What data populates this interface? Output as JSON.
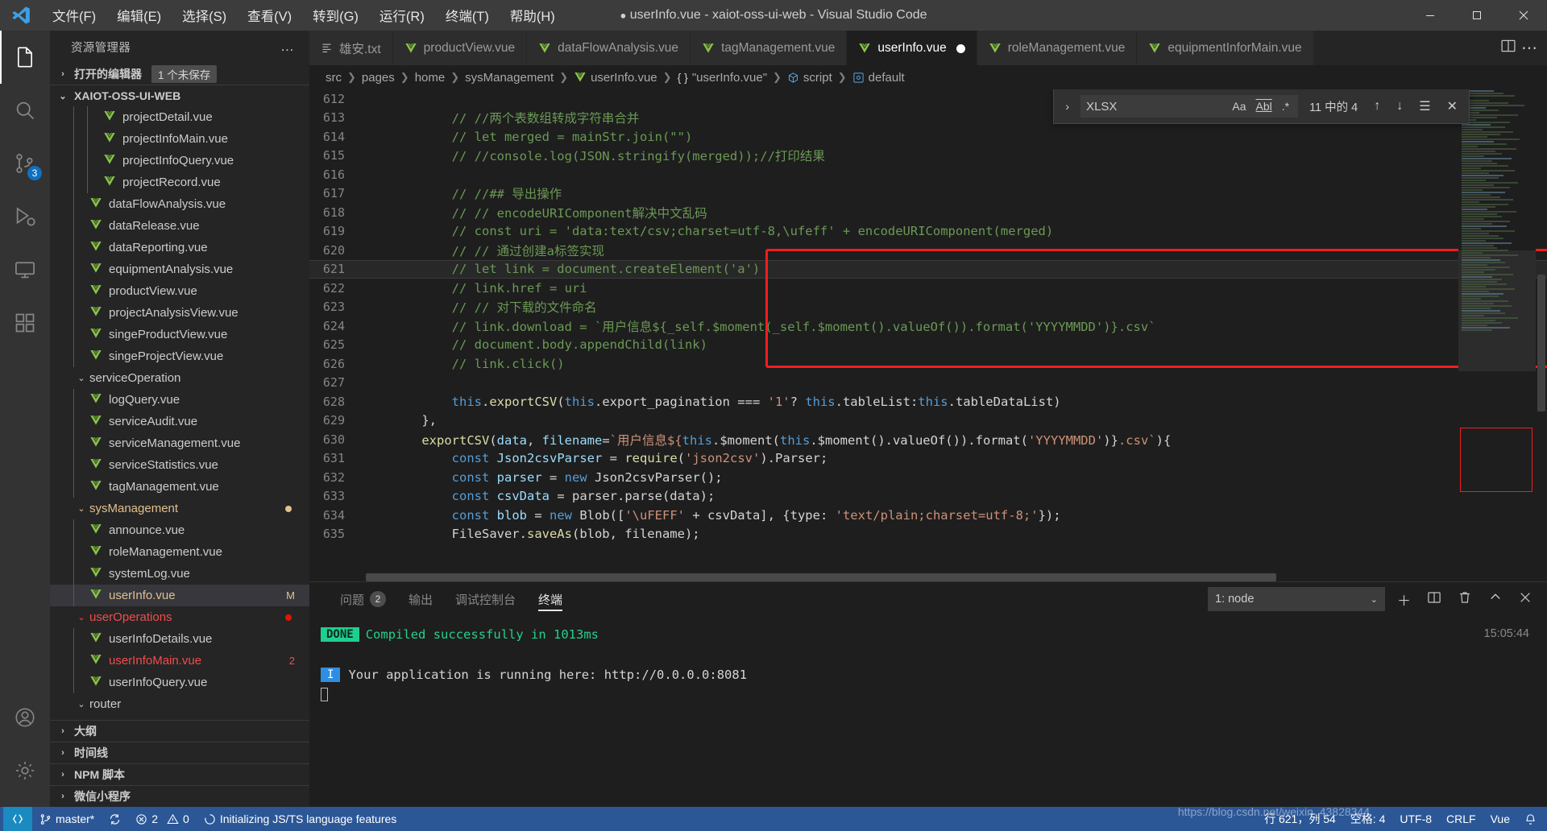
{
  "window": {
    "title_dirty_marker": "●",
    "title": "userInfo.vue - xaiot-oss-ui-web - Visual Studio Code",
    "menus": [
      "文件(F)",
      "编辑(E)",
      "选择(S)",
      "查看(V)",
      "转到(G)",
      "运行(R)",
      "终端(T)",
      "帮助(H)"
    ],
    "controls": {
      "minimize": "―",
      "maximize": "☐",
      "close": "✕"
    }
  },
  "activitybar": {
    "items": [
      {
        "name": "explorer",
        "icon": "files-icon",
        "badge": ""
      },
      {
        "name": "search",
        "icon": "search-icon",
        "badge": ""
      },
      {
        "name": "source-control",
        "icon": "source-control-icon",
        "badge": "3"
      },
      {
        "name": "run-debug",
        "icon": "run-debug-icon",
        "badge": ""
      },
      {
        "name": "remote-explorer",
        "icon": "remote-explorer-icon",
        "badge": ""
      },
      {
        "name": "extensions",
        "icon": "extensions-icon",
        "badge": ""
      }
    ],
    "bottom": [
      {
        "name": "accounts",
        "icon": "account-icon"
      },
      {
        "name": "settings",
        "icon": "gear-icon"
      }
    ]
  },
  "sidebar": {
    "header": "资源管理器",
    "more_actions": "…",
    "open_editors": {
      "label": "打开的编辑器",
      "badge": "1 个未保存",
      "chevron": "›"
    },
    "workspace": {
      "label": "XAIOT-OSS-UI-WEB",
      "chevron": "⌄"
    },
    "tree": [
      {
        "label": "projectDetail.vue",
        "depth": 3,
        "type": "vue",
        "state": "normal"
      },
      {
        "label": "projectInfoMain.vue",
        "depth": 3,
        "type": "vue",
        "state": "normal"
      },
      {
        "label": "projectInfoQuery.vue",
        "depth": 3,
        "type": "vue",
        "state": "normal"
      },
      {
        "label": "projectRecord.vue",
        "depth": 3,
        "type": "vue",
        "state": "normal"
      },
      {
        "label": "dataFlowAnalysis.vue",
        "depth": 2,
        "type": "vue",
        "state": "normal"
      },
      {
        "label": "dataRelease.vue",
        "depth": 2,
        "type": "vue",
        "state": "normal"
      },
      {
        "label": "dataReporting.vue",
        "depth": 2,
        "type": "vue",
        "state": "normal"
      },
      {
        "label": "equipmentAnalysis.vue",
        "depth": 2,
        "type": "vue",
        "state": "normal"
      },
      {
        "label": "productView.vue",
        "depth": 2,
        "type": "vue",
        "state": "normal"
      },
      {
        "label": "projectAnalysisView.vue",
        "depth": 2,
        "type": "vue",
        "state": "normal"
      },
      {
        "label": "singeProductView.vue",
        "depth": 2,
        "type": "vue",
        "state": "normal"
      },
      {
        "label": "singeProjectView.vue",
        "depth": 2,
        "type": "vue",
        "state": "normal"
      },
      {
        "label": "serviceOperation",
        "depth": 1,
        "type": "folder-open",
        "state": "normal"
      },
      {
        "label": "logQuery.vue",
        "depth": 2,
        "type": "vue",
        "state": "normal"
      },
      {
        "label": "serviceAudit.vue",
        "depth": 2,
        "type": "vue",
        "state": "normal"
      },
      {
        "label": "serviceManagement.vue",
        "depth": 2,
        "type": "vue",
        "state": "normal"
      },
      {
        "label": "serviceStatistics.vue",
        "depth": 2,
        "type": "vue",
        "state": "normal"
      },
      {
        "label": "tagManagement.vue",
        "depth": 2,
        "type": "vue",
        "state": "normal"
      },
      {
        "label": "sysManagement",
        "depth": 1,
        "type": "folder-open",
        "state": "modified-folder",
        "badge_dot": "#e2c08d"
      },
      {
        "label": "announce.vue",
        "depth": 2,
        "type": "vue",
        "state": "normal"
      },
      {
        "label": "roleManagement.vue",
        "depth": 2,
        "type": "vue",
        "state": "normal"
      },
      {
        "label": "systemLog.vue",
        "depth": 2,
        "type": "vue",
        "state": "normal"
      },
      {
        "label": "userInfo.vue",
        "depth": 2,
        "type": "vue",
        "state": "modified",
        "badge": "M",
        "selected": true
      },
      {
        "label": "userOperations",
        "depth": 1,
        "type": "folder-open",
        "state": "error-folder",
        "badge_dot": "#e51400"
      },
      {
        "label": "userInfoDetails.vue",
        "depth": 2,
        "type": "vue",
        "state": "normal"
      },
      {
        "label": "userInfoMain.vue",
        "depth": 2,
        "type": "vue",
        "state": "error",
        "badge": "2"
      },
      {
        "label": "userInfoQuery.vue",
        "depth": 2,
        "type": "vue",
        "state": "normal"
      },
      {
        "label": "router",
        "depth": 1,
        "type": "folder-open",
        "state": "normal"
      }
    ],
    "panels": [
      {
        "label": "大纲",
        "chevron": "›"
      },
      {
        "label": "时间线",
        "chevron": "›"
      },
      {
        "label": "NPM 脚本",
        "chevron": "›"
      },
      {
        "label": "微信小程序",
        "chevron": "›"
      }
    ]
  },
  "editor": {
    "tabs": [
      {
        "label": "雄安.txt",
        "icon": "txt-icon",
        "active": false,
        "dirty": false
      },
      {
        "label": "productView.vue",
        "icon": "vue-icon",
        "active": false,
        "dirty": false
      },
      {
        "label": "dataFlowAnalysis.vue",
        "icon": "vue-icon",
        "active": false,
        "dirty": false
      },
      {
        "label": "tagManagement.vue",
        "icon": "vue-icon",
        "active": false,
        "dirty": false
      },
      {
        "label": "userInfo.vue",
        "icon": "vue-icon",
        "active": true,
        "dirty": true
      },
      {
        "label": "roleManagement.vue",
        "icon": "vue-icon",
        "active": false,
        "dirty": false
      },
      {
        "label": "equipmentInforMain.vue",
        "icon": "vue-icon",
        "active": false,
        "dirty": false
      }
    ],
    "tab_actions": [
      {
        "name": "split-editor-icon",
        "glyph": "▤"
      },
      {
        "name": "more-actions-icon",
        "glyph": "⋯"
      }
    ],
    "breadcrumb": [
      {
        "label": "src",
        "icon": ""
      },
      {
        "label": "pages",
        "icon": ""
      },
      {
        "label": "home",
        "icon": ""
      },
      {
        "label": "sysManagement",
        "icon": ""
      },
      {
        "label": "userInfo.vue",
        "icon": "vue-icon"
      },
      {
        "label": "\"userInfo.vue\"",
        "icon": "braces-icon"
      },
      {
        "label": "script",
        "icon": "module-icon"
      },
      {
        "label": "default",
        "icon": "property-icon"
      }
    ],
    "find": {
      "expand_chevron": "›",
      "query": "XLSX",
      "match_case": "Aa",
      "whole_word": "Abl",
      "regex": ".*",
      "count": "11 中的 4",
      "prev": "↑",
      "next": "↓",
      "find_in_selection": "☰",
      "close": "✕"
    },
    "first_line_number": 612,
    "lines": [
      {
        "n": 612,
        "tokens": []
      },
      {
        "n": 613,
        "tokens": [
          {
            "t": "        // //两个表数组转成字符串合并",
            "c": "c-com"
          }
        ]
      },
      {
        "n": 614,
        "tokens": [
          {
            "t": "        // let merged = mainStr.join(\"\")",
            "c": "c-com"
          }
        ]
      },
      {
        "n": 615,
        "tokens": [
          {
            "t": "        // //console.log(JSON.stringify(merged));//打印结果",
            "c": "c-com"
          }
        ]
      },
      {
        "n": 616,
        "tokens": []
      },
      {
        "n": 617,
        "tokens": [
          {
            "t": "        // //## 导出操作",
            "c": "c-com"
          }
        ]
      },
      {
        "n": 618,
        "tokens": [
          {
            "t": "        // // encodeURIComponent解决中文乱码",
            "c": "c-com"
          }
        ]
      },
      {
        "n": 619,
        "tokens": [
          {
            "t": "        // const uri = 'data:text/csv;charset=utf-8,\\ufeff' + encodeURIComponent(merged)",
            "c": "c-com"
          }
        ]
      },
      {
        "n": 620,
        "tokens": [
          {
            "t": "        // // 通过创建a标签实现",
            "c": "c-com"
          }
        ]
      },
      {
        "n": 621,
        "tokens": [
          {
            "t": "        // let link = document.createElement('a')",
            "c": "c-com"
          }
        ],
        "highlight": true
      },
      {
        "n": 622,
        "tokens": [
          {
            "t": "        // link.href = uri",
            "c": "c-com"
          }
        ]
      },
      {
        "n": 623,
        "tokens": [
          {
            "t": "        // // 对下载的文件命名",
            "c": "c-com"
          }
        ]
      },
      {
        "n": 624,
        "tokens": [
          {
            "t": "        // link.download = `用户信息${_self.$moment(_self.$moment().valueOf()).format('YYYYMMDD')}.csv`",
            "c": "c-com"
          }
        ]
      },
      {
        "n": 625,
        "tokens": [
          {
            "t": "        // document.body.appendChild(link)",
            "c": "c-com"
          }
        ]
      },
      {
        "n": 626,
        "tokens": [
          {
            "t": "        // link.click()",
            "c": "c-com"
          }
        ]
      },
      {
        "n": 627,
        "tokens": []
      },
      {
        "n": 628,
        "tokens": [
          {
            "t": "        ",
            "c": "c-plain"
          },
          {
            "t": "this",
            "c": "c-this"
          },
          {
            "t": ".",
            "c": "c-plain"
          },
          {
            "t": "exportCSV",
            "c": "c-fn"
          },
          {
            "t": "(",
            "c": "c-plain"
          },
          {
            "t": "this",
            "c": "c-this"
          },
          {
            "t": ".export_pagination === ",
            "c": "c-plain"
          },
          {
            "t": "'1'",
            "c": "c-str"
          },
          {
            "t": "? ",
            "c": "c-plain"
          },
          {
            "t": "this",
            "c": "c-this"
          },
          {
            "t": ".tableList:",
            "c": "c-plain"
          },
          {
            "t": "this",
            "c": "c-this"
          },
          {
            "t": ".tableDataList)",
            "c": "c-plain"
          }
        ]
      },
      {
        "n": 629,
        "tokens": [
          {
            "t": "    },",
            "c": "c-plain"
          }
        ]
      },
      {
        "n": 630,
        "tokens": [
          {
            "t": "    ",
            "c": "c-plain"
          },
          {
            "t": "exportCSV",
            "c": "c-fn"
          },
          {
            "t": "(",
            "c": "c-plain"
          },
          {
            "t": "data",
            "c": "c-var"
          },
          {
            "t": ", ",
            "c": "c-plain"
          },
          {
            "t": "filename",
            "c": "c-var"
          },
          {
            "t": "=",
            "c": "c-plain"
          },
          {
            "t": "`用户信息${",
            "c": "c-str"
          },
          {
            "t": "this",
            "c": "c-this"
          },
          {
            "t": ".$moment(",
            "c": "c-plain"
          },
          {
            "t": "this",
            "c": "c-this"
          },
          {
            "t": ".$moment().valueOf()).format(",
            "c": "c-plain"
          },
          {
            "t": "'YYYYMMDD'",
            "c": "c-str"
          },
          {
            "t": ")}",
            "c": "c-plain"
          },
          {
            "t": ".csv`",
            "c": "c-str"
          },
          {
            "t": "){",
            "c": "c-plain"
          }
        ]
      },
      {
        "n": 631,
        "tokens": [
          {
            "t": "        ",
            "c": "c-plain"
          },
          {
            "t": "const",
            "c": "c-kw"
          },
          {
            "t": " ",
            "c": "c-plain"
          },
          {
            "t": "Json2csvParser",
            "c": "c-var"
          },
          {
            "t": " = ",
            "c": "c-plain"
          },
          {
            "t": "require",
            "c": "c-fn"
          },
          {
            "t": "(",
            "c": "c-plain"
          },
          {
            "t": "'json2csv'",
            "c": "c-str"
          },
          {
            "t": ").Parser;",
            "c": "c-plain"
          }
        ]
      },
      {
        "n": 632,
        "tokens": [
          {
            "t": "        ",
            "c": "c-plain"
          },
          {
            "t": "const",
            "c": "c-kw"
          },
          {
            "t": " ",
            "c": "c-plain"
          },
          {
            "t": "parser",
            "c": "c-var"
          },
          {
            "t": " = ",
            "c": "c-plain"
          },
          {
            "t": "new",
            "c": "c-kw"
          },
          {
            "t": " Json2csvParser();",
            "c": "c-plain"
          }
        ]
      },
      {
        "n": 633,
        "tokens": [
          {
            "t": "        ",
            "c": "c-plain"
          },
          {
            "t": "const",
            "c": "c-kw"
          },
          {
            "t": " ",
            "c": "c-plain"
          },
          {
            "t": "csvData",
            "c": "c-var"
          },
          {
            "t": " = parser.parse(data);",
            "c": "c-plain"
          }
        ]
      },
      {
        "n": 634,
        "tokens": [
          {
            "t": "        ",
            "c": "c-plain"
          },
          {
            "t": "const",
            "c": "c-kw"
          },
          {
            "t": " ",
            "c": "c-plain"
          },
          {
            "t": "blob",
            "c": "c-var"
          },
          {
            "t": " = ",
            "c": "c-plain"
          },
          {
            "t": "new",
            "c": "c-kw"
          },
          {
            "t": " Blob([",
            "c": "c-plain"
          },
          {
            "t": "'\\uFEFF'",
            "c": "c-str"
          },
          {
            "t": " + csvData], {type: ",
            "c": "c-plain"
          },
          {
            "t": "'text/plain;charset=utf-8;'",
            "c": "c-str"
          },
          {
            "t": "});",
            "c": "c-plain"
          }
        ]
      },
      {
        "n": 635,
        "tokens": [
          {
            "t": "        FileSaver.",
            "c": "c-plain"
          },
          {
            "t": "saveAs",
            "c": "c-fn"
          },
          {
            "t": "(blob, filename);",
            "c": "c-plain"
          }
        ]
      }
    ]
  },
  "panel": {
    "tabs": [
      {
        "label": "问题",
        "badge": "2",
        "active": false
      },
      {
        "label": "输出",
        "badge": "",
        "active": false
      },
      {
        "label": "调试控制台",
        "badge": "",
        "active": false
      },
      {
        "label": "终端",
        "badge": "",
        "active": true
      }
    ],
    "terminal_select": "1: node",
    "actions": [
      {
        "name": "new-terminal-icon",
        "glyph": "＋"
      },
      {
        "name": "split-terminal-icon",
        "glyph": "▥"
      },
      {
        "name": "kill-terminal-icon",
        "glyph": "🗑"
      },
      {
        "name": "maximize-panel-icon",
        "glyph": "⌃"
      },
      {
        "name": "close-panel-icon",
        "glyph": "✕"
      }
    ],
    "terminal": {
      "done_tag": "DONE",
      "done_message": "Compiled successfully in 1013ms",
      "info_tag": "I",
      "info_message": "Your application is running here: http://0.0.0.0:8081",
      "timestamp": "15:05:44"
    }
  },
  "statusbar": {
    "remote_icon": "remote-icon",
    "branch_icon": "git-branch-icon",
    "branch": "master*",
    "sync_icon": "sync-icon",
    "problems": {
      "error_icon": "error-icon",
      "errors": "2",
      "warning_icon": "warning-icon",
      "warnings": "0"
    },
    "task": {
      "icon": "loading-icon",
      "label": "Initializing JS/TS language features"
    },
    "position": "行 621，列 54",
    "indentation": "空格: 4",
    "encoding": "UTF-8",
    "eol": "CRLF",
    "language": "Vue",
    "feedback_icon": "bell-icon",
    "watermark": "https://blog.csdn.net/weixin_43828344"
  }
}
